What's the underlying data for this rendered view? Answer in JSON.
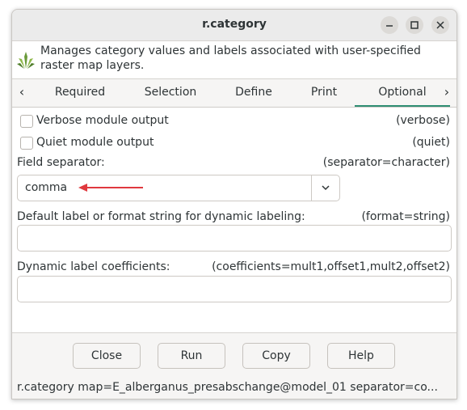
{
  "window": {
    "title": "r.category"
  },
  "controls": {
    "minimize": "–",
    "maximize": "□",
    "close": "×"
  },
  "description": "Manages category values and labels associated with user-specified raster map layers.",
  "tabs": {
    "prev_arrow": "‹",
    "next_arrow": "›",
    "items": [
      {
        "label": "Required"
      },
      {
        "label": "Selection"
      },
      {
        "label": "Define"
      },
      {
        "label": "Print"
      },
      {
        "label": "Optional",
        "active": true
      }
    ]
  },
  "options": {
    "verbose": {
      "label": "Verbose module output",
      "flag": "(verbose)",
      "checked": false
    },
    "quiet": {
      "label": "Quiet module output",
      "flag": "(quiet)",
      "checked": false
    },
    "separator": {
      "label": "Field separator:",
      "param": "(separator=character)",
      "value": "comma"
    },
    "format": {
      "label": "Default label or format string for dynamic labeling:",
      "param": "(format=string)",
      "value": ""
    },
    "coefficients": {
      "label": "Dynamic label coefficients:",
      "param": "(coefficients=mult1,offset1,mult2,offset2)",
      "value": ""
    }
  },
  "buttons": {
    "close": "Close",
    "run": "Run",
    "copy": "Copy",
    "help": "Help"
  },
  "command_line": "r.category map=E_alberganus_presabschange@model_01 separator=co...",
  "colors": {
    "accent": "#2f8e73",
    "annotation_arrow": "#e0393e"
  },
  "icons": {
    "module": "grass-icon",
    "dropdown": "chevron-down-icon",
    "annotation": "red-arrow-icon"
  }
}
